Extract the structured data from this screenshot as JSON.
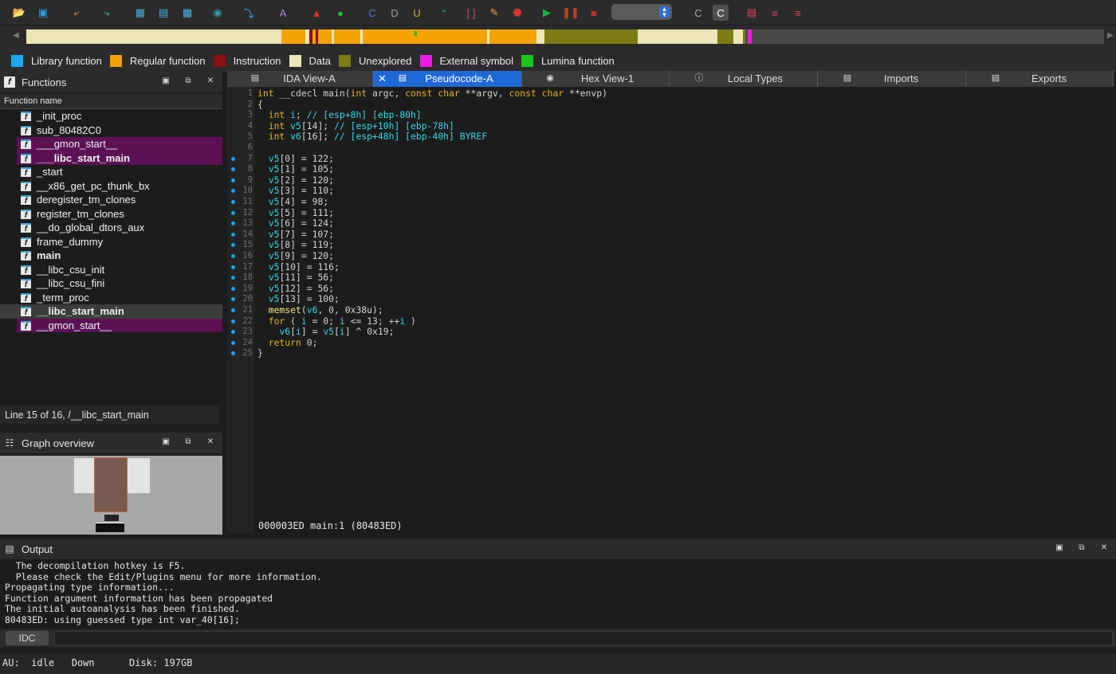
{
  "toolbar": {
    "icons": [
      "open-icon",
      "save-icon",
      "back-icon",
      "forward-icon",
      "hex-icon",
      "text-icon",
      "struct-icon",
      "graph-icon",
      "jump-icon",
      "font-icon",
      "flag-icon",
      "run-icon",
      "code-icon",
      "data-icon",
      "undefine-icon",
      "string-icon",
      "array-icon",
      "rename-icon",
      "stop-icon",
      "play-icon",
      "pause-icon",
      "terminate-icon",
      "c-icon",
      "c-active-icon",
      "list-icon",
      "tree-icon",
      "tree2-icon"
    ],
    "debugger_select": ""
  },
  "legend": [
    {
      "label": "Library function",
      "color": "#18a9f2"
    },
    {
      "label": "Regular function",
      "color": "#f4a300"
    },
    {
      "label": "Instruction",
      "color": "#8a0f0f"
    },
    {
      "label": "Data",
      "color": "#ede6b8"
    },
    {
      "label": "Unexplored",
      "color": "#7e7c12"
    },
    {
      "label": "External symbol",
      "color": "#ef1be8"
    },
    {
      "label": "Lumina function",
      "color": "#1ac71a"
    }
  ],
  "functions_panel": {
    "title": "Functions",
    "column_header": "Function name",
    "items": [
      {
        "name": "_init_proc",
        "bold": false,
        "style": "normal"
      },
      {
        "name": "sub_80482C0",
        "bold": false,
        "style": "normal"
      },
      {
        "name": "___gmon_start__",
        "bold": false,
        "style": "purple"
      },
      {
        "name": "___libc_start_main",
        "bold": true,
        "style": "purple"
      },
      {
        "name": "_start",
        "bold": false,
        "style": "normal"
      },
      {
        "name": "__x86_get_pc_thunk_bx",
        "bold": false,
        "style": "normal"
      },
      {
        "name": "deregister_tm_clones",
        "bold": false,
        "style": "normal"
      },
      {
        "name": "register_tm_clones",
        "bold": false,
        "style": "normal"
      },
      {
        "name": "__do_global_dtors_aux",
        "bold": false,
        "style": "normal"
      },
      {
        "name": "frame_dummy",
        "bold": false,
        "style": "normal"
      },
      {
        "name": "main",
        "bold": true,
        "style": "normal"
      },
      {
        "name": "__libc_csu_init",
        "bold": false,
        "style": "normal"
      },
      {
        "name": "__libc_csu_fini",
        "bold": false,
        "style": "normal"
      },
      {
        "name": "_term_proc",
        "bold": false,
        "style": "normal"
      },
      {
        "name": "__libc_start_main",
        "bold": true,
        "style": "selected"
      },
      {
        "name": "__gmon_start__",
        "bold": false,
        "style": "purple"
      }
    ],
    "status": "Line 15 of 16, /__libc_start_main"
  },
  "graph_panel": {
    "title": "Graph overview"
  },
  "tabs": [
    {
      "label": "IDA View-A",
      "active": false
    },
    {
      "label": "Pseudocode-A",
      "active": true
    },
    {
      "label": "Hex View-1",
      "active": false
    },
    {
      "label": "Local Types",
      "active": false
    },
    {
      "label": "Imports",
      "active": false
    },
    {
      "label": "Exports",
      "active": false
    }
  ],
  "code": {
    "lines": [
      "int __cdecl main(int argc, const char **argv, const char **envp)",
      "{",
      "  int i; // [esp+8h] [ebp-80h]",
      "  int v5[14]; // [esp+10h] [ebp-78h]",
      "  int v6[16]; // [esp+48h] [ebp-40h] BYREF",
      "",
      "  v5[0] = 122;",
      "  v5[1] = 105;",
      "  v5[2] = 120;",
      "  v5[3] = 110;",
      "  v5[4] = 98;",
      "  v5[5] = 111;",
      "  v5[6] = 124;",
      "  v5[7] = 107;",
      "  v5[8] = 119;",
      "  v5[9] = 120;",
      "  v5[10] = 116;",
      "  v5[11] = 56;",
      "  v5[12] = 56;",
      "  v5[13] = 100;",
      "  memset(v6, 0, 0x38u);",
      "  for ( i = 0; i <= 13; ++i )",
      "    v6[i] = v5[i] ^ 0x19;",
      "  return 0;",
      "}"
    ],
    "status": "000003ED main:1 (80483ED)"
  },
  "output": {
    "title": "Output",
    "lines": [
      "  The decompilation hotkey is F5.",
      "  Please check the Edit/Plugins menu for more information.",
      "Propagating type information...",
      "Function argument information has been propagated",
      "The initial autoanalysis has been finished.",
      "80483ED: using guessed type int var_40[16];"
    ],
    "idc_label": "IDC"
  },
  "status_bar": {
    "au": "AU:",
    "state": "idle",
    "direction": "Down",
    "disk": "Disk: 197GB"
  }
}
